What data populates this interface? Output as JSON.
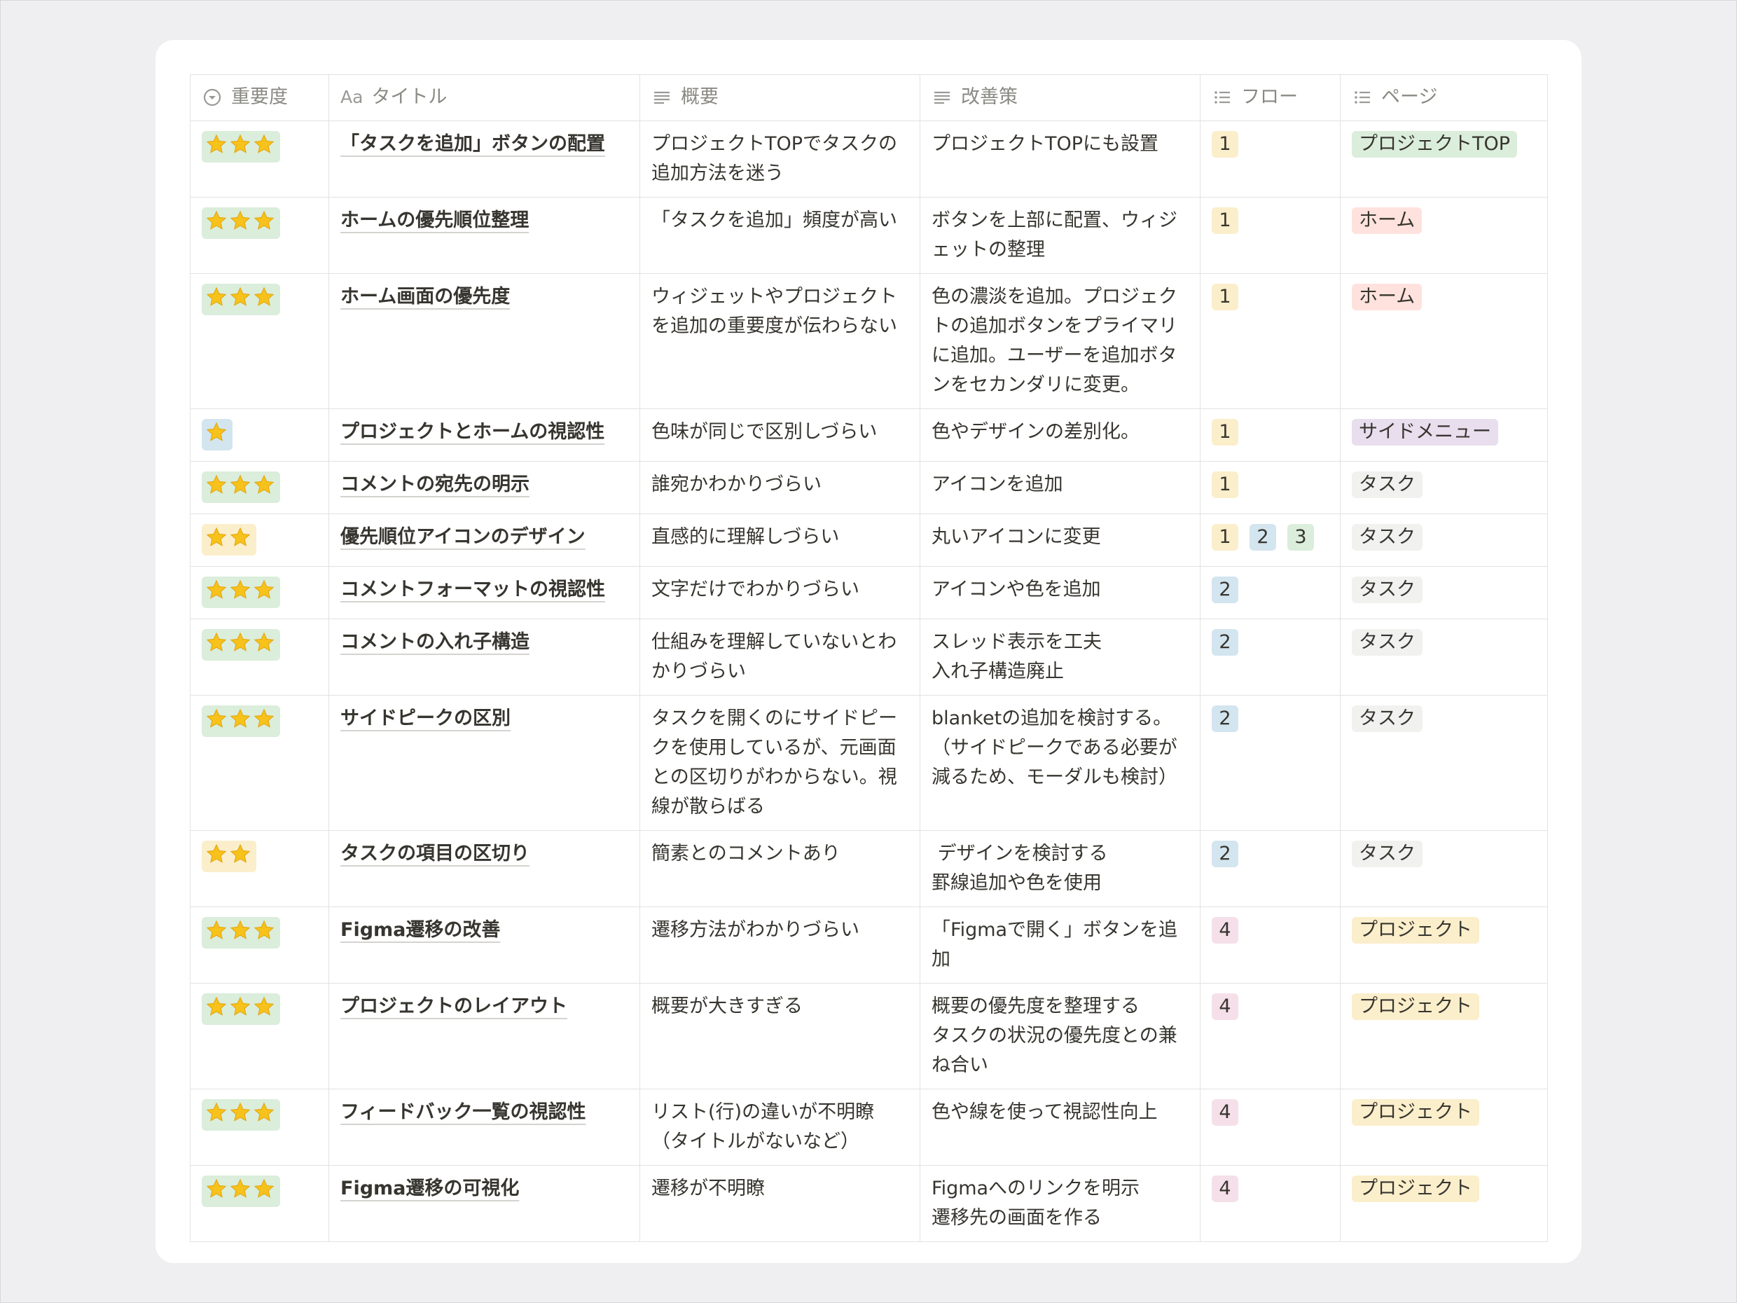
{
  "headers": {
    "importance": "重要度",
    "title_icon": "Aa",
    "title": "タイトル",
    "summary": "概要",
    "improvement": "改善策",
    "flow": "フロー",
    "page": "ページ"
  },
  "colors": {
    "star": "#f7c21b",
    "green": "#dbeddb",
    "blue": "#d3e5ef",
    "orange": "#fadec9",
    "yellow": "#fbeecb",
    "red": "#ffe2dd",
    "purple": "#e8deee",
    "gray": "#f1f1ef",
    "pink": "#f5e0e9"
  },
  "rows": [
    {
      "stars": 3,
      "importance_color": "green",
      "title": "「タスクを追加」ボタンの配置",
      "summary": "プロジェクトTOPでタスクの追加方法を迷う",
      "improvement": "プロジェクトTOPにも設置",
      "flow": [
        {
          "v": "1",
          "c": "yellow"
        }
      ],
      "page": "プロジェクトTOP",
      "page_color": "green"
    },
    {
      "stars": 3,
      "importance_color": "green",
      "title": "ホームの優先順位整理",
      "summary": "「タスクを追加」頻度が高い",
      "improvement": "ボタンを上部に配置、ウィジェットの整理",
      "flow": [
        {
          "v": "1",
          "c": "yellow"
        }
      ],
      "page": "ホーム",
      "page_color": "red"
    },
    {
      "stars": 3,
      "importance_color": "green",
      "title": "ホーム画面の優先度",
      "summary": "ウィジェットやプロジェクトを追加の重要度が伝わらない",
      "improvement": "色の濃淡を追加。プロジェクトの追加ボタンをプライマリに追加。ユーザーを追加ボタンをセカンダリに変更。",
      "flow": [
        {
          "v": "1",
          "c": "yellow"
        }
      ],
      "page": "ホーム",
      "page_color": "red"
    },
    {
      "stars": 1,
      "importance_color": "blue",
      "title": "プロジェクトとホームの視認性",
      "summary": "色味が同じで区別しづらい",
      "improvement": "色やデザインの差別化。",
      "flow": [
        {
          "v": "1",
          "c": "yellow"
        }
      ],
      "page": "サイドメニュー",
      "page_color": "purple"
    },
    {
      "stars": 3,
      "importance_color": "green",
      "title": "コメントの宛先の明示",
      "summary": "誰宛かわかりづらい",
      "improvement": "アイコンを追加",
      "flow": [
        {
          "v": "1",
          "c": "yellow"
        }
      ],
      "page": "タスク",
      "page_color": "gray"
    },
    {
      "stars": 2,
      "importance_color": "yellow",
      "title": "優先順位アイコンのデザイン",
      "summary": "直感的に理解しづらい",
      "improvement": "丸いアイコンに変更",
      "flow": [
        {
          "v": "1",
          "c": "yellow"
        },
        {
          "v": "2",
          "c": "blue"
        },
        {
          "v": "3",
          "c": "green"
        }
      ],
      "page": "タスク",
      "page_color": "gray"
    },
    {
      "stars": 3,
      "importance_color": "green",
      "title": "コメントフォーマットの視認性",
      "summary": "文字だけでわかりづらい",
      "improvement": "アイコンや色を追加",
      "flow": [
        {
          "v": "2",
          "c": "blue"
        }
      ],
      "page": "タスク",
      "page_color": "gray"
    },
    {
      "stars": 3,
      "importance_color": "green",
      "title": "コメントの入れ子構造",
      "summary": "仕組みを理解していないとわかりづらい",
      "improvement": "スレッド表示を工夫\n入れ子構造廃止",
      "flow": [
        {
          "v": "2",
          "c": "blue"
        }
      ],
      "page": "タスク",
      "page_color": "gray"
    },
    {
      "stars": 3,
      "importance_color": "green",
      "title": "サイドピークの区別",
      "summary": "タスクを開くのにサイドピークを使用しているが、元画面との区切りがわからない。視線が散らばる",
      "improvement": "blanketの追加を検討する。（サイドピークである必要が減るため、モーダルも検討）",
      "flow": [
        {
          "v": "2",
          "c": "blue"
        }
      ],
      "page": "タスク",
      "page_color": "gray"
    },
    {
      "stars": 2,
      "importance_color": "yellow",
      "title": "タスクの項目の区切り",
      "summary": "簡素とのコメントあり",
      "improvement": " デザインを検討する\n罫線追加や色を使用",
      "flow": [
        {
          "v": "2",
          "c": "blue"
        }
      ],
      "page": "タスク",
      "page_color": "gray"
    },
    {
      "stars": 3,
      "importance_color": "green",
      "title": "Figma遷移の改善",
      "summary": "遷移方法がわかりづらい",
      "improvement": "「Figmaで開く」ボタンを追加",
      "flow": [
        {
          "v": "4",
          "c": "pink"
        }
      ],
      "page": "プロジェクト",
      "page_color": "yellow"
    },
    {
      "stars": 3,
      "importance_color": "green",
      "title": "プロジェクトのレイアウト",
      "summary": "概要が大きすぎる",
      "improvement": "概要の優先度を整理する\nタスクの状況の優先度との兼ね合い",
      "flow": [
        {
          "v": "4",
          "c": "pink"
        }
      ],
      "page": "プロジェクト",
      "page_color": "yellow"
    },
    {
      "stars": 3,
      "importance_color": "green",
      "title": "フィードバック一覧の視認性",
      "summary": "リスト(行)の違いが不明瞭（タイトルがないなど）",
      "improvement": "色や線を使って視認性向上",
      "flow": [
        {
          "v": "4",
          "c": "pink"
        }
      ],
      "page": "プロジェクト",
      "page_color": "yellow"
    },
    {
      "stars": 3,
      "importance_color": "green",
      "title": "Figma遷移の可視化",
      "summary": "遷移が不明瞭",
      "improvement": "Figmaへのリンクを明示\n遷移先の画面を作る",
      "flow": [
        {
          "v": "4",
          "c": "pink"
        }
      ],
      "page": "プロジェクト",
      "page_color": "yellow"
    }
  ]
}
